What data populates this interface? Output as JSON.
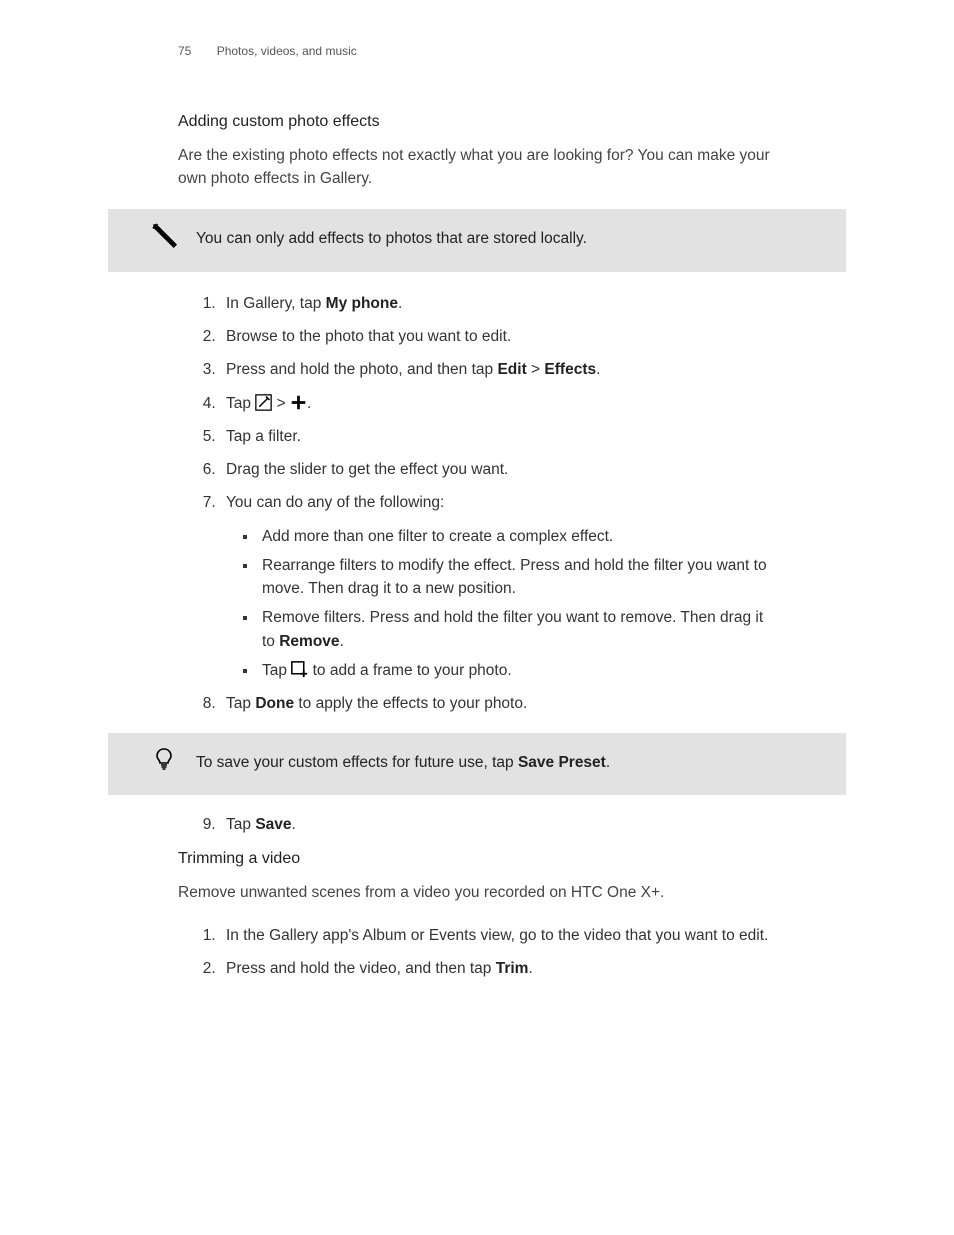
{
  "header": {
    "page_number": "75",
    "chapter": "Photos, videos, and music"
  },
  "section1": {
    "title": "Adding custom photo effects",
    "intro": "Are the existing photo effects not exactly what you are looking for? You can make your own photo effects in Gallery."
  },
  "note1": {
    "text": "You can only add effects to photos that are stored locally."
  },
  "steps": {
    "s1_a": "In Gallery, tap ",
    "s1_b": "My phone",
    "s1_c": ".",
    "s2": "Browse to the photo that you want to edit.",
    "s3_a": "Press and hold the photo, and then tap ",
    "s3_b": "Edit",
    "s3_c": " > ",
    "s3_d": "Effects",
    "s3_e": ".",
    "s4_a": "Tap ",
    "s4_b": " > ",
    "s4_c": ".",
    "s5": "Tap a filter.",
    "s6": "Drag the slider to get the effect you want.",
    "s7": "You can do any of the following:",
    "s7_b1": "Add more than one filter to create a complex effect.",
    "s7_b2": "Rearrange filters to modify the effect. Press and hold the filter you want to move. Then drag it to a new position.",
    "s7_b3_a": "Remove filters. Press and hold the filter you want to remove. Then drag it to ",
    "s7_b3_b": "Remove",
    "s7_b3_c": ".",
    "s7_b4_a": "Tap ",
    "s7_b4_b": " to add a frame to your photo.",
    "s8_a": "Tap ",
    "s8_b": "Done",
    "s8_c": " to apply the effects to your photo."
  },
  "tip": {
    "text_a": "To save your custom effects for future use, tap ",
    "text_b": "Save Preset",
    "text_c": "."
  },
  "steps2": {
    "s9_a": "Tap ",
    "s9_b": "Save",
    "s9_c": "."
  },
  "section2": {
    "title": "Trimming a video",
    "intro": "Remove unwanted scenes from a video you recorded on HTC One X+."
  },
  "steps3": {
    "s1": "In the Gallery app's Album or Events view, go to the video that you want to edit.",
    "s2_a": "Press and hold the video, and then tap ",
    "s2_b": "Trim",
    "s2_c": "."
  }
}
